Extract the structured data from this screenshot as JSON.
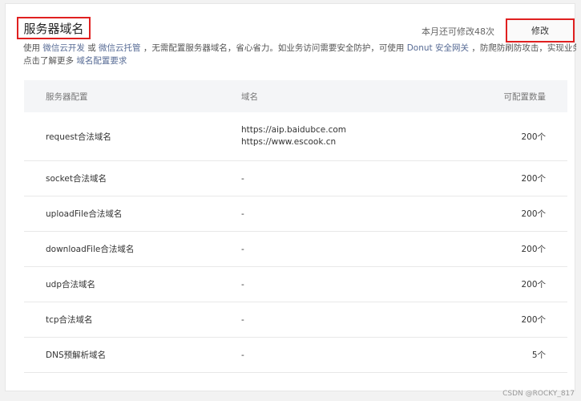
{
  "header": {
    "title": "服务器域名",
    "quota_text": "本月还可修改48次",
    "modify_label": "修改"
  },
  "description": {
    "line1_prefix": "使用",
    "link1": "微信云开发",
    "or": "或",
    "link2": "微信云托管",
    "middle": "，无需配置服务器域名，省心省力。如业务访问需要安全防护，可使用",
    "link3": "Donut 安全网关",
    "suffix": "，防爬防刷防攻击，实现业务安全。",
    "line2_prefix": "点击了解更多",
    "link4": "域名配置要求"
  },
  "table": {
    "headers": [
      "服务器配置",
      "域名",
      "可配置数量"
    ],
    "rows": [
      {
        "config": "request合法域名",
        "domains": [
          "https://aip.baidubce.com",
          "https://www.escook.cn"
        ],
        "count": "200个"
      },
      {
        "config": "socket合法域名",
        "domains": [
          "-"
        ],
        "count": "200个"
      },
      {
        "config": "uploadFile合法域名",
        "domains": [
          "-"
        ],
        "count": "200个"
      },
      {
        "config": "downloadFile合法域名",
        "domains": [
          "-"
        ],
        "count": "200个"
      },
      {
        "config": "udp合法域名",
        "domains": [
          "-"
        ],
        "count": "200个"
      },
      {
        "config": "tcp合法域名",
        "domains": [
          "-"
        ],
        "count": "200个"
      },
      {
        "config": "DNS预解析域名",
        "domains": [
          "-"
        ],
        "count": "5个"
      }
    ]
  },
  "watermark": "CSDN @ROCKY_817"
}
